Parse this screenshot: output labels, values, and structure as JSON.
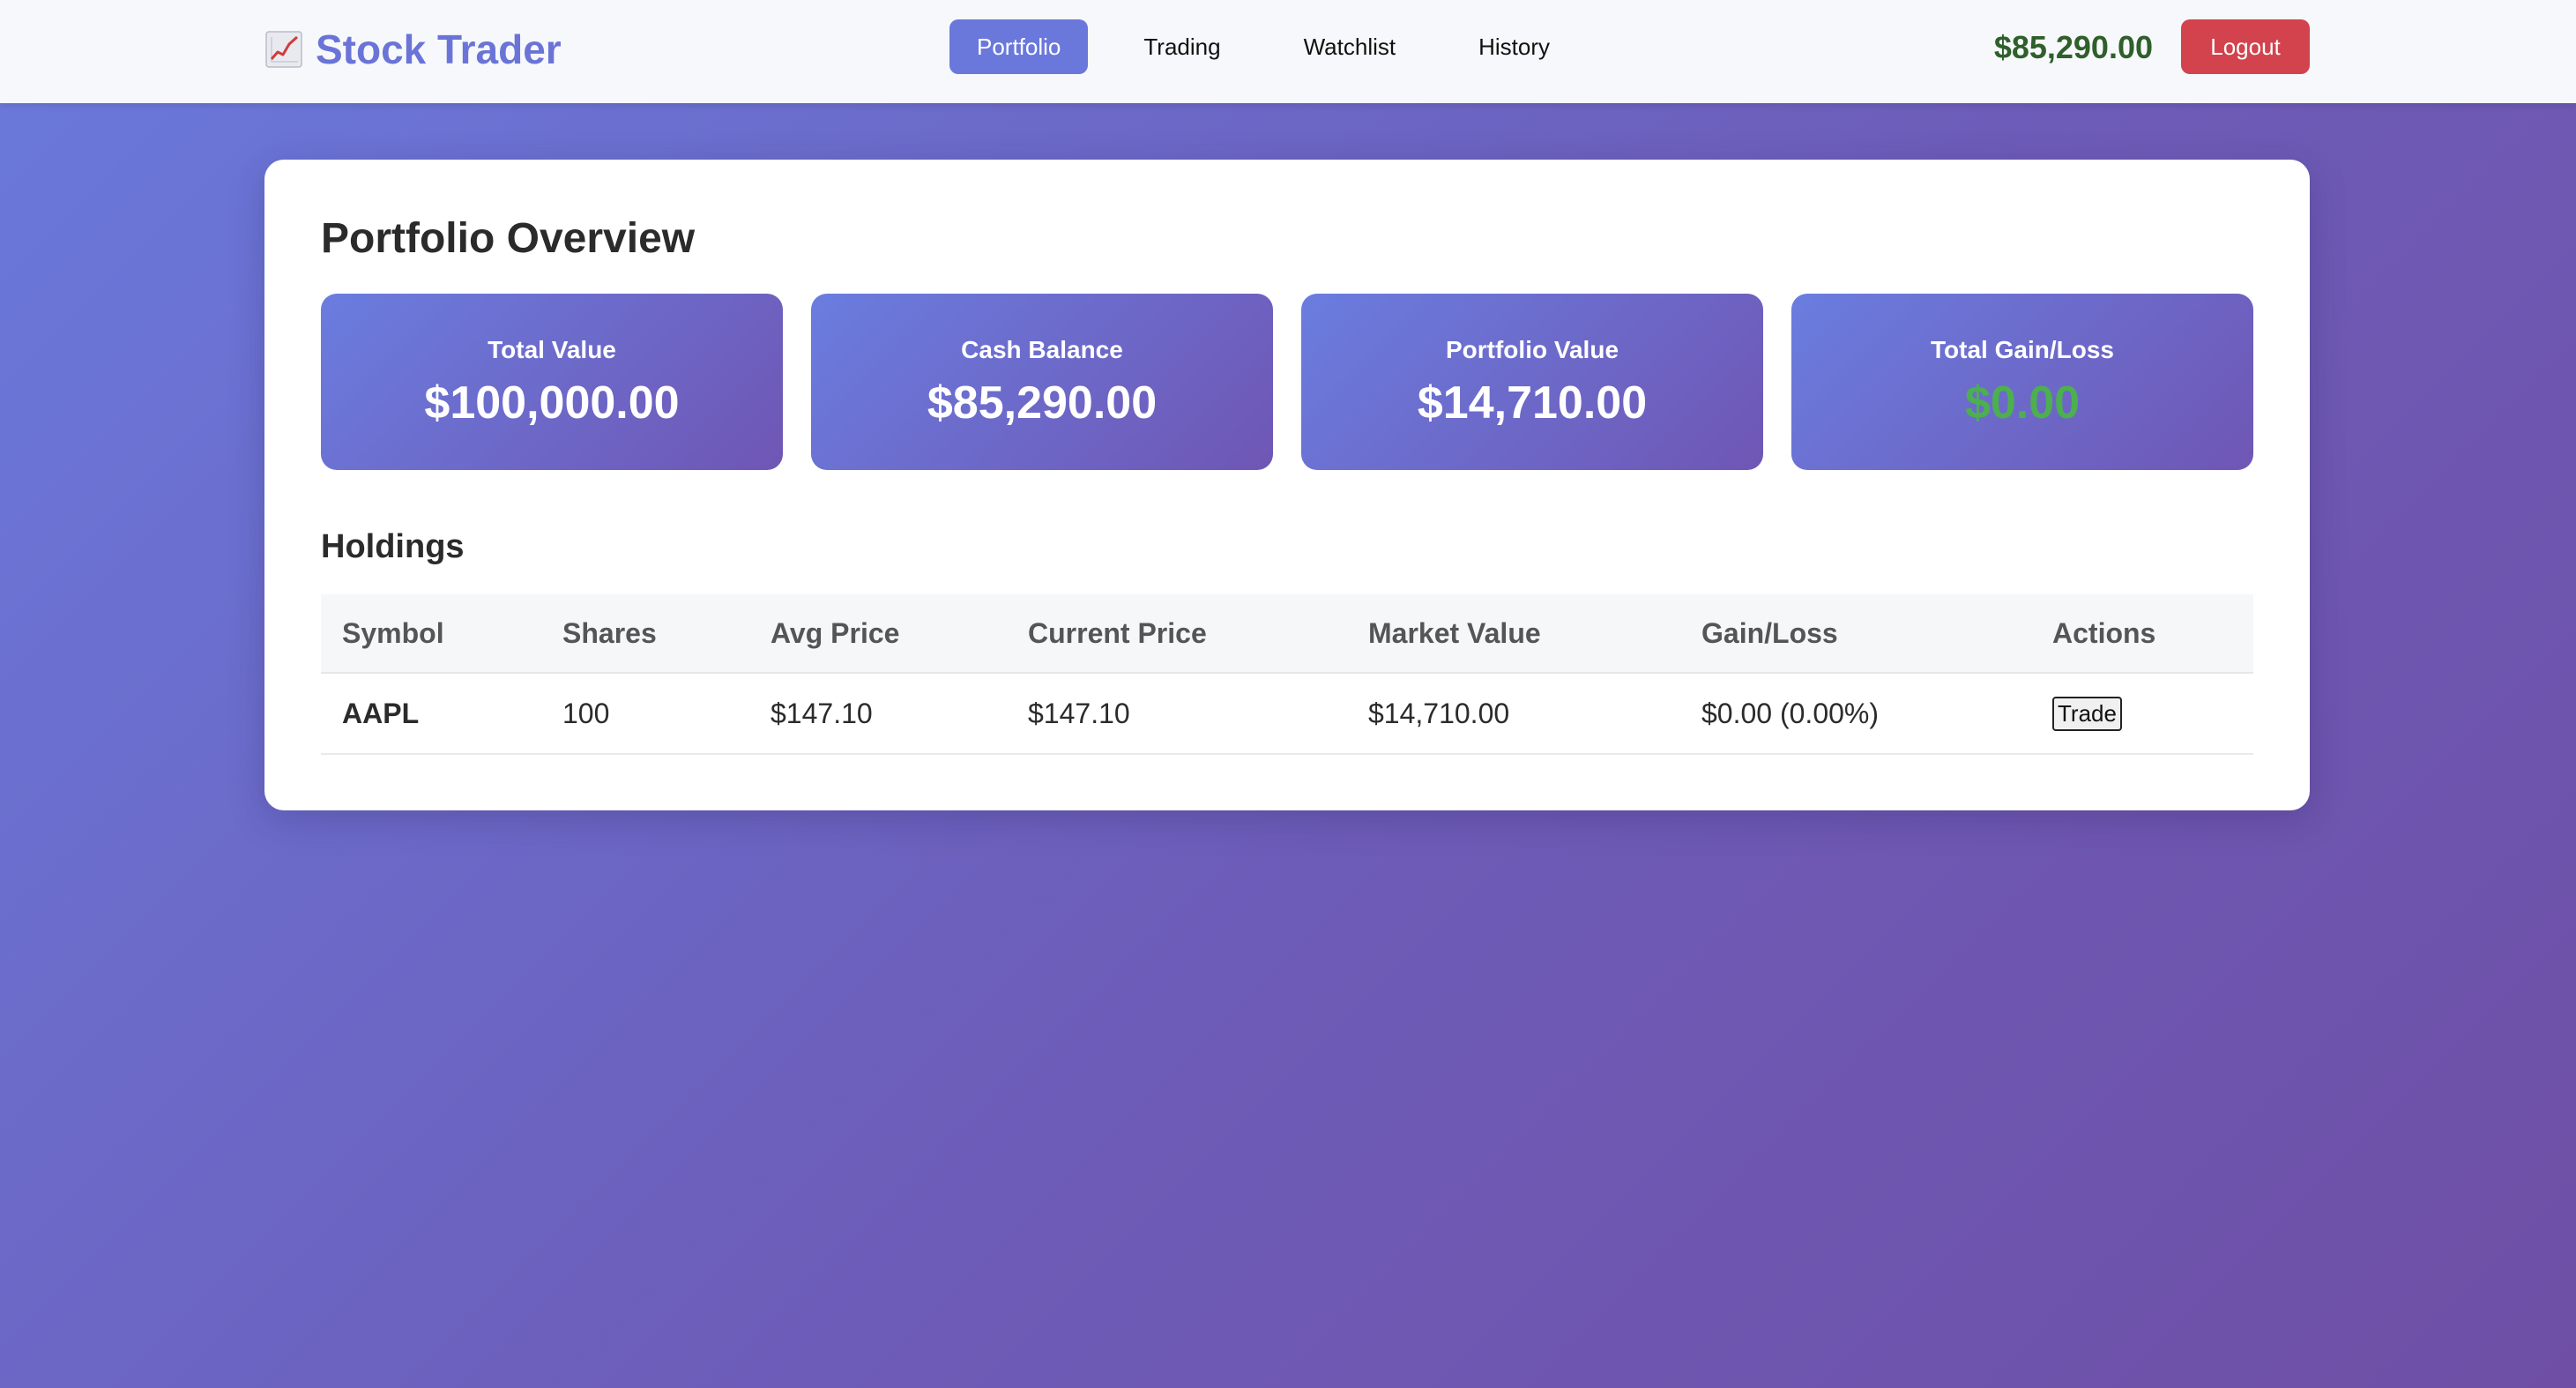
{
  "header": {
    "brand_name": "Stock Trader",
    "brand_icon": "chart-increasing-icon",
    "nav": [
      {
        "label": "Portfolio",
        "active": true
      },
      {
        "label": "Trading",
        "active": false
      },
      {
        "label": "Watchlist",
        "active": false
      },
      {
        "label": "History",
        "active": false
      }
    ],
    "balance": "$85,290.00",
    "logout_label": "Logout"
  },
  "page": {
    "title": "Portfolio Overview",
    "stats": [
      {
        "label": "Total Value",
        "value": "$100,000.00"
      },
      {
        "label": "Cash Balance",
        "value": "$85,290.00"
      },
      {
        "label": "Portfolio Value",
        "value": "$14,710.00"
      },
      {
        "label": "Total Gain/Loss",
        "value": "$0.00"
      }
    ]
  },
  "holdings": {
    "title": "Holdings",
    "columns": [
      "Symbol",
      "Shares",
      "Avg Price",
      "Current Price",
      "Market Value",
      "Gain/Loss",
      "Actions"
    ],
    "rows": [
      {
        "symbol": "AAPL",
        "shares": "100",
        "avg_price": "$147.10",
        "current_price": "$147.10",
        "market_value": "$14,710.00",
        "gain_loss": "$0.00 (0.00%)",
        "action_label": "Trade"
      }
    ]
  },
  "colors": {
    "accent": "#6a78dc",
    "logout": "#d2434d",
    "gain": "#4caf50",
    "balance": "#2f5f2b"
  }
}
